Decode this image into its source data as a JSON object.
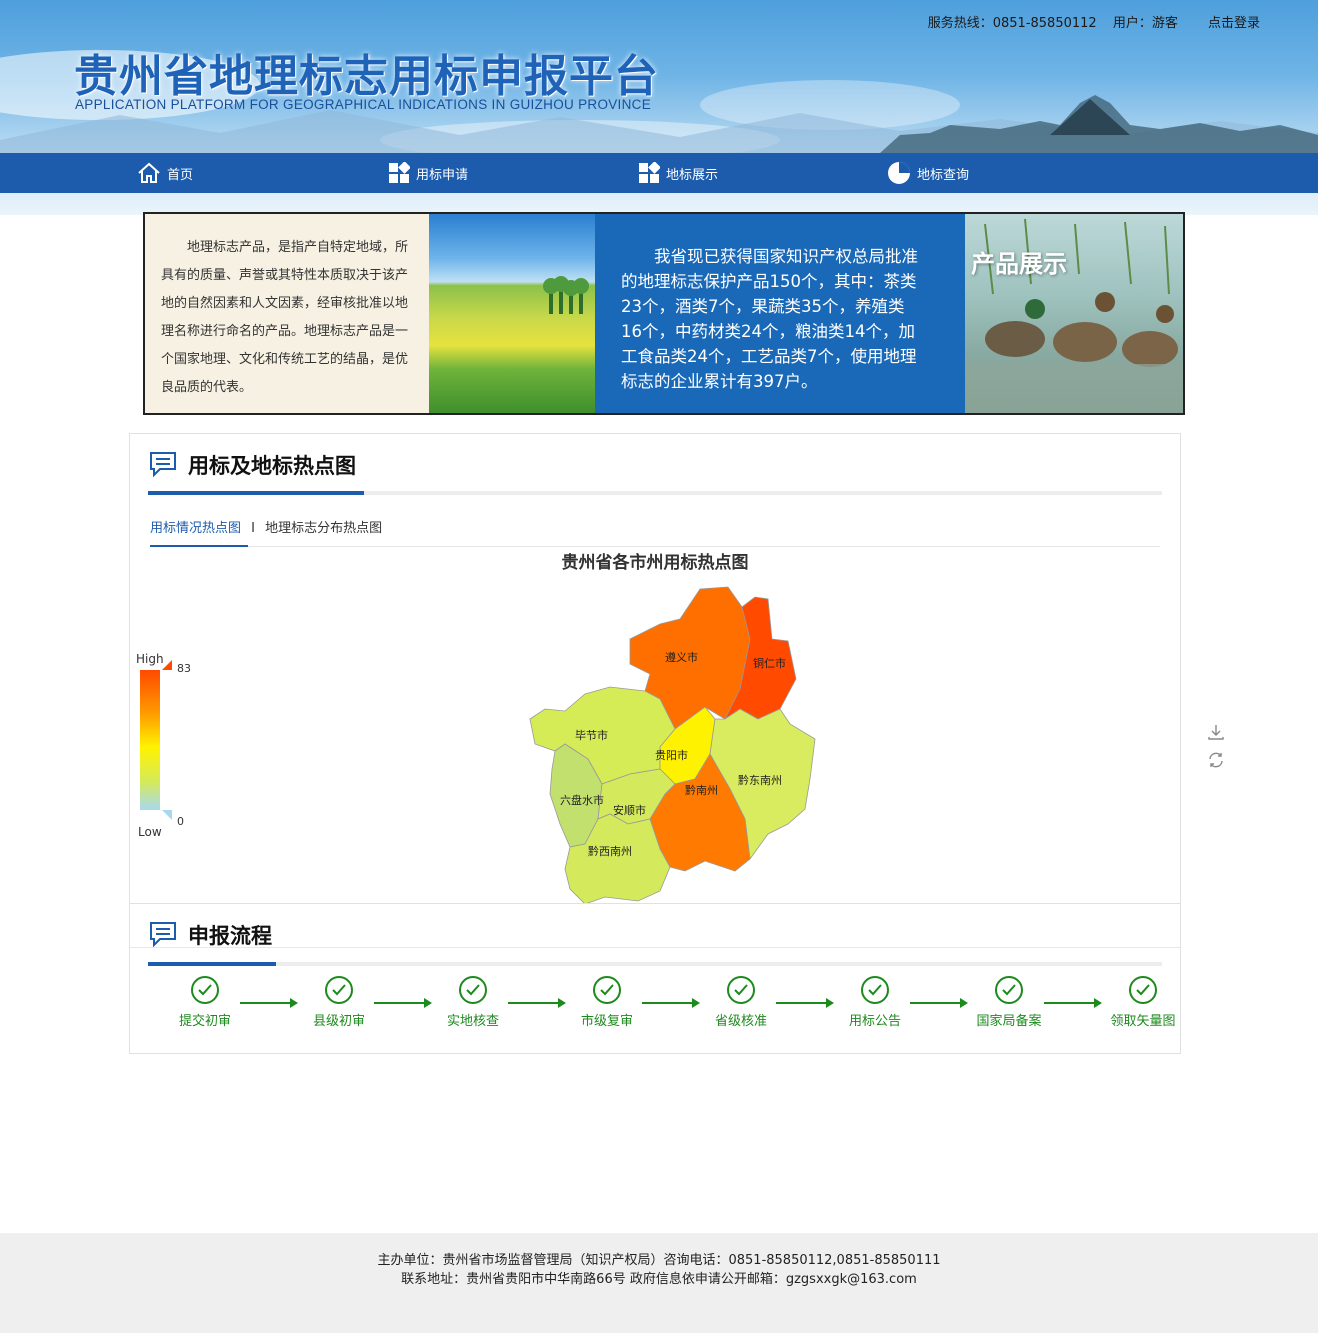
{
  "header": {
    "hotline": "服务热线：0851-85850112",
    "user": "用户：游客",
    "login": "点击登录",
    "title": "贵州省地理标志用标申报平台",
    "subtitle": "APPLICATION PLATFORM FOR GEOGRAPHICAL INDICATIONS IN GUIZHOU PROVINCE"
  },
  "nav": {
    "items": [
      {
        "label": "首页",
        "icon": "home-icon"
      },
      {
        "label": "用标申请",
        "icon": "grid-icon"
      },
      {
        "label": "地标展示",
        "icon": "grid-icon"
      },
      {
        "label": "地标查询",
        "icon": "pie-icon"
      }
    ]
  },
  "banner": {
    "intro": "地理标志产品，是指产自特定地域，所具有的质量、声誉或其特性本质取决于该产地的自然因素和人文因素，经审核批准以地理名称进行命名的产品。地理标志产品是一个国家地理、文化和传统工艺的结晶，是优良品质的代表。",
    "stats": "我省现已获得国家知识产权总局批准的地理标志保护产品150个，其中：茶类23个，酒类7个，果蔬类35个，养殖类16个，中药材类24个，粮油类14个，加工食品类24个，工艺品类7个，使用地理标志的企业累计有397户。",
    "showcase_title": "产品展示"
  },
  "hotmap": {
    "section_title": "用标及地标热点图",
    "tab_active": "用标情况热点图",
    "tab_separator": "I",
    "tab_other": "地理标志分布热点图",
    "map_title": "贵州省各市州用标热点图",
    "legend": {
      "high": "High",
      "low": "Low",
      "max": "83",
      "min": "0"
    },
    "regions": [
      {
        "name": "遵义市",
        "color": "#ff6f00"
      },
      {
        "name": "铜仁市",
        "color": "#ff4a00"
      },
      {
        "name": "毕节市",
        "color": "#d6ec57"
      },
      {
        "name": "贵阳市",
        "color": "#fff200"
      },
      {
        "name": "黔东南州",
        "color": "#d9ec5f"
      },
      {
        "name": "黔南州",
        "color": "#ff7a00"
      },
      {
        "name": "六盘水市",
        "color": "#c2e06e"
      },
      {
        "name": "安顺市",
        "color": "#d4ea5c"
      },
      {
        "name": "黔西南州",
        "color": "#d4ea5c"
      }
    ]
  },
  "process": {
    "section_title": "申报流程",
    "steps": [
      "提交初审",
      "县级初审",
      "实地核查",
      "市级复审",
      "省级核准",
      "用标公告",
      "国家局备案",
      "领取矢量图"
    ]
  },
  "footer": {
    "line1": "主办单位：贵州省市场监督管理局（知识产权局）咨询电话：0851-85850112,0851-85850111",
    "line2": "联系地址：贵州省贵阳市中华南路66号 政府信息依申请公开邮箱：gzgsxxgk@163.com"
  }
}
